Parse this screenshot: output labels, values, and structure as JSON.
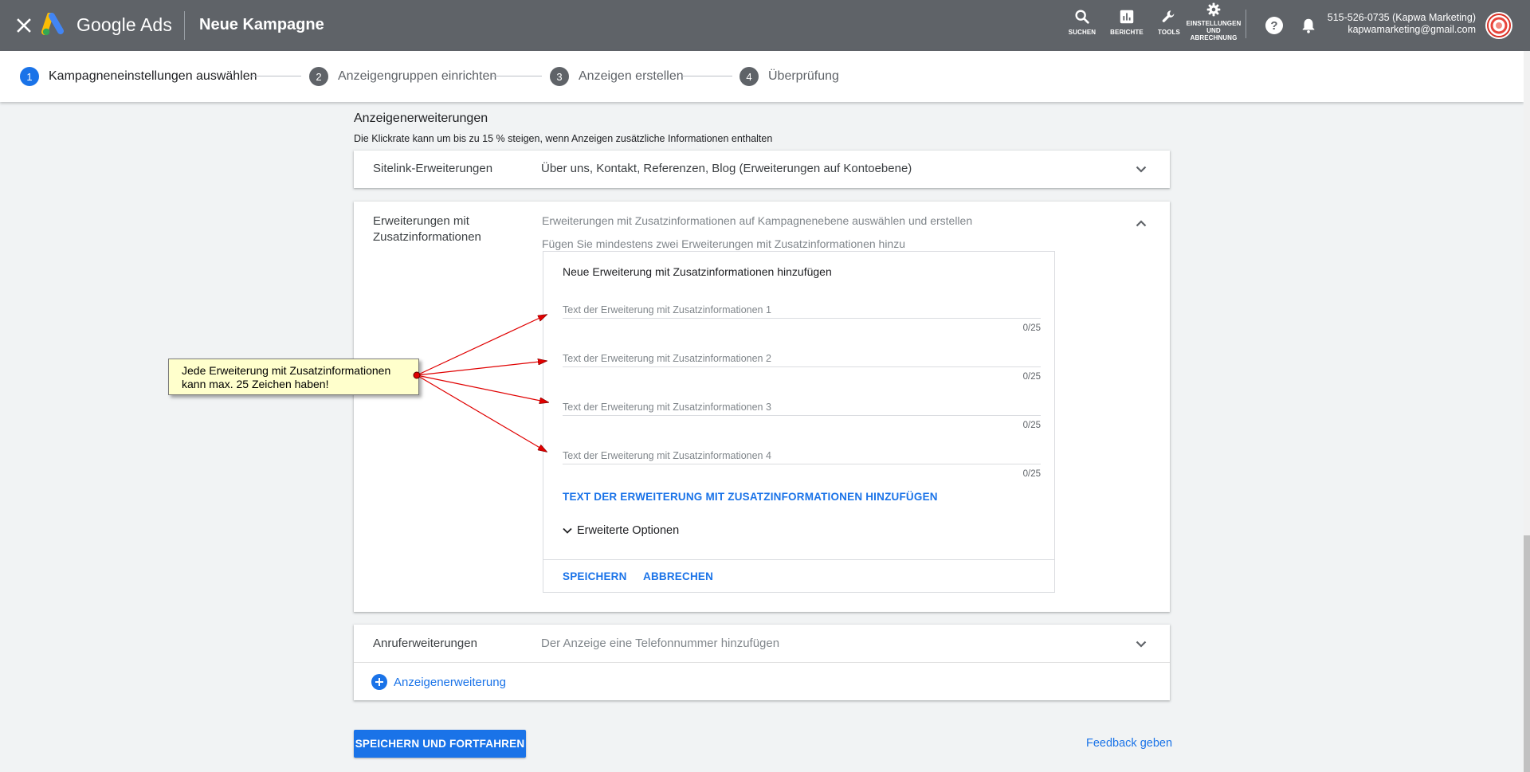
{
  "header": {
    "product": "Google Ads",
    "page_title": "Neue Kampagne",
    "tools": [
      {
        "label": "SUCHEN"
      },
      {
        "label": "BERICHTE"
      },
      {
        "label": "TOOLS"
      },
      {
        "label": "EINSTELLUNGEN UND ABRECHNUNG"
      }
    ],
    "account_line1": "515-526-0735 (Kapwa Marketing)",
    "account_line2": "kapwamarketing@gmail.com"
  },
  "stepper": {
    "steps": [
      {
        "num": "1",
        "label": "Kampagneneinstellungen auswählen"
      },
      {
        "num": "2",
        "label": "Anzeigengruppen einrichten"
      },
      {
        "num": "3",
        "label": "Anzeigen erstellen"
      },
      {
        "num": "4",
        "label": "Überprüfung"
      }
    ]
  },
  "section": {
    "title": "Anzeigenerweiterungen",
    "subtitle": "Die Klickrate kann um bis zu 15 % steigen, wenn Anzeigen zusätzliche Informationen enthalten"
  },
  "sitelinks": {
    "label": "Sitelink-Erweiterungen",
    "value": "Über uns, Kontakt, Referenzen, Blog (Erweiterungen auf Kontoebene)"
  },
  "callouts": {
    "label_line1": "Erweiterungen mit",
    "label_line2": "Zusatzinformationen",
    "hint1": "Erweiterungen mit Zusatzinformationen auf Kampagnenebene auswählen und erstellen",
    "hint2": "Fügen Sie mindestens zwei Erweiterungen mit Zusatzinformationen hinzu",
    "form_title": "Neue Erweiterung mit Zusatzinformationen hinzufügen",
    "fields": [
      {
        "placeholder": "Text der Erweiterung mit Zusatzinformationen 1",
        "value": "",
        "counter": "0/25"
      },
      {
        "placeholder": "Text der Erweiterung mit Zusatzinformationen 2",
        "value": "",
        "counter": "0/25"
      },
      {
        "placeholder": "Text der Erweiterung mit Zusatzinformationen 3",
        "value": "",
        "counter": "0/25"
      },
      {
        "placeholder": "Text der Erweiterung mit Zusatzinformationen 4",
        "value": "",
        "counter": "0/25"
      }
    ],
    "add_text": "TEXT DER ERWEITERUNG MIT ZUSATZINFORMATIONEN HINZUFÜGEN",
    "advanced": "Erweiterte Optionen",
    "save": "SPEICHERN",
    "cancel": "ABBRECHEN"
  },
  "calls": {
    "label": "Anruferweiterungen",
    "value": "Der Anzeige eine Telefonnummer hinzufügen",
    "add_extension": "Anzeigenerweiterung"
  },
  "footer": {
    "primary": "SPEICHERN UND FORTFAHREN",
    "feedback": "Feedback geben"
  },
  "annotation": {
    "line1": "Jede Erweiterung mit Zusatzinformationen",
    "line2": "kann max. 25 Zeichen haben!"
  },
  "colors": {
    "topbar": "#5f6368",
    "accent": "#1a73e8",
    "annotation_fill": "#ffffcc",
    "arrow": "#e00000"
  }
}
